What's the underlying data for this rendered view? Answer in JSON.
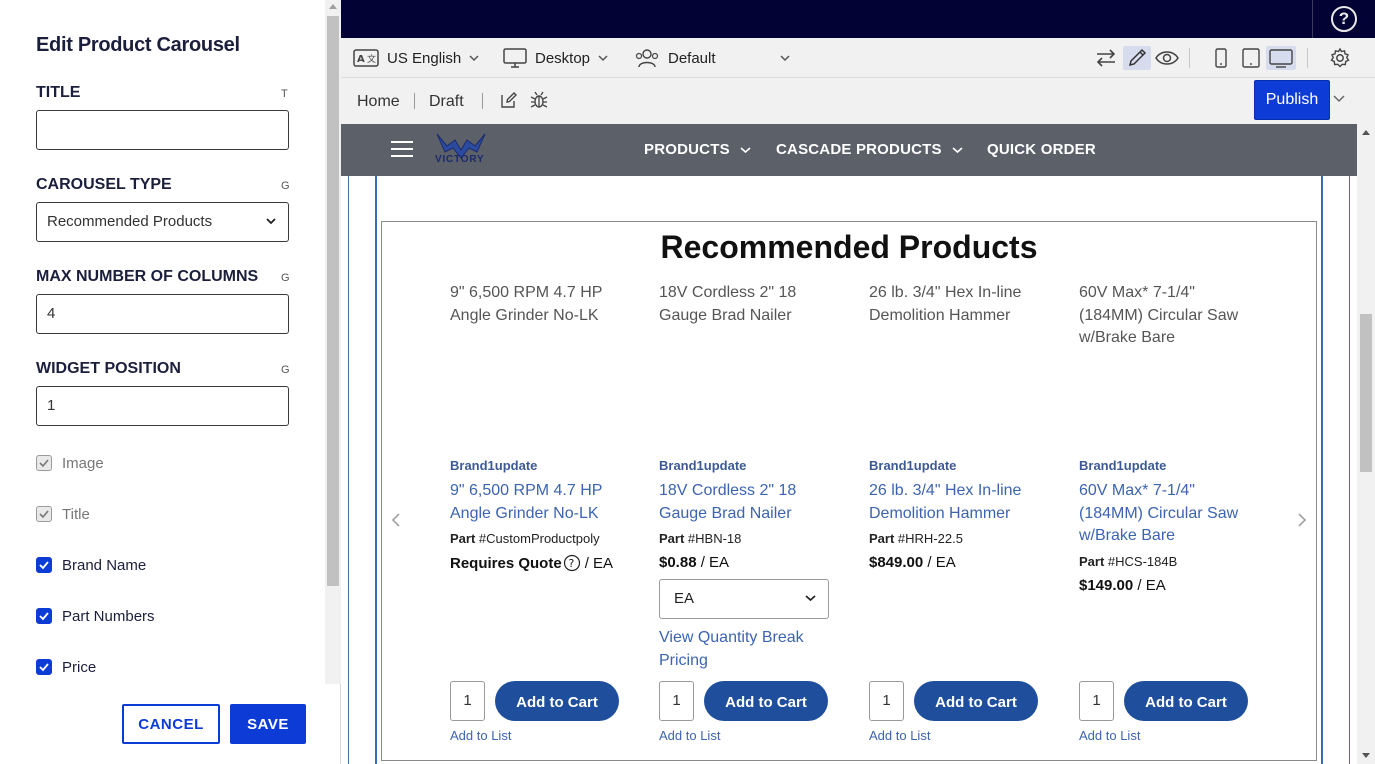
{
  "editor": {
    "title": "Edit Product Carousel",
    "fields": {
      "title": {
        "label": "TITLE",
        "hint": "T",
        "value": ""
      },
      "carousel_type": {
        "label": "CAROUSEL TYPE",
        "hint": "G",
        "value": "Recommended Products"
      },
      "max_columns": {
        "label": "MAX NUMBER OF COLUMNS",
        "hint": "G",
        "value": "4"
      },
      "widget_position": {
        "label": "WIDGET POSITION",
        "hint": "G",
        "value": "1"
      }
    },
    "checkboxes": [
      {
        "label": "Image",
        "checked": true,
        "disabled": true
      },
      {
        "label": "Title",
        "checked": true,
        "disabled": true
      },
      {
        "label": "Brand Name",
        "checked": true,
        "disabled": false
      },
      {
        "label": "Part Numbers",
        "checked": true,
        "disabled": false
      },
      {
        "label": "Price",
        "checked": true,
        "disabled": false
      }
    ],
    "cancel_label": "CANCEL",
    "save_label": "SAVE"
  },
  "topbar": {
    "help_label": "?"
  },
  "toolbar": {
    "language": "US English",
    "device": "Desktop",
    "persona": "Default"
  },
  "crumbs": {
    "home": "Home",
    "draft": "Draft",
    "publish_label": "Publish"
  },
  "site": {
    "logo_text": "VICTORY",
    "nav": [
      "PRODUCTS",
      "CASCADE PRODUCTS",
      "QUICK ORDER"
    ]
  },
  "carousel": {
    "title": "Recommended Products",
    "products": [
      {
        "img_alt": "9\" 6,500 RPM 4.7 HP Angle Grinder No-LK",
        "brand": "Brand1update",
        "name": "9\" 6,500 RPM 4.7 HP Angle Grinder No-LK",
        "part_label": "Part",
        "part": "#CustomProductpoly",
        "price": "Requires Quote",
        "uom": "/ EA",
        "qty": "1",
        "add_cart": "Add to Cart",
        "add_list": "Add to List"
      },
      {
        "img_alt": "18V Cordless 2\" 18 Gauge Brad Nailer",
        "brand": "Brand1update",
        "name": "18V Cordless 2\" 18 Gauge Brad Nailer",
        "part_label": "Part",
        "part": "#HBN-18",
        "price": "$0.88",
        "uom": "/ EA",
        "uom_select": "EA",
        "quantity_break": "View Quantity Break Pricing",
        "qty": "1",
        "add_cart": "Add to Cart",
        "add_list": "Add to List"
      },
      {
        "img_alt": "26 lb. 3/4\" Hex In-line Demolition Hammer",
        "brand": "Brand1update",
        "name": "26 lb. 3/4\" Hex In-line Demolition Hammer",
        "part_label": "Part",
        "part": "#HRH-22.5",
        "price": "$849.00",
        "uom": "/ EA",
        "qty": "1",
        "add_cart": "Add to Cart",
        "add_list": "Add to List"
      },
      {
        "img_alt": "60V Max* 7-1/4\" (184MM) Circular Saw w/Brake Bare",
        "brand": "Brand1update",
        "name": "60V Max* 7-1/4\" (184MM) Circular Saw w/Brake Bare",
        "part_label": "Part",
        "part": "#HCS-184B",
        "price": "$149.00",
        "uom": "/ EA",
        "qty": "1",
        "add_cart": "Add to Cart",
        "add_list": "Add to List"
      }
    ]
  },
  "colors": {
    "primary": "#0d3bd6",
    "topbar": "#020334",
    "site_nav": "#5b6069",
    "link": "#3d64b0",
    "cart_button": "#1f4f9c"
  }
}
